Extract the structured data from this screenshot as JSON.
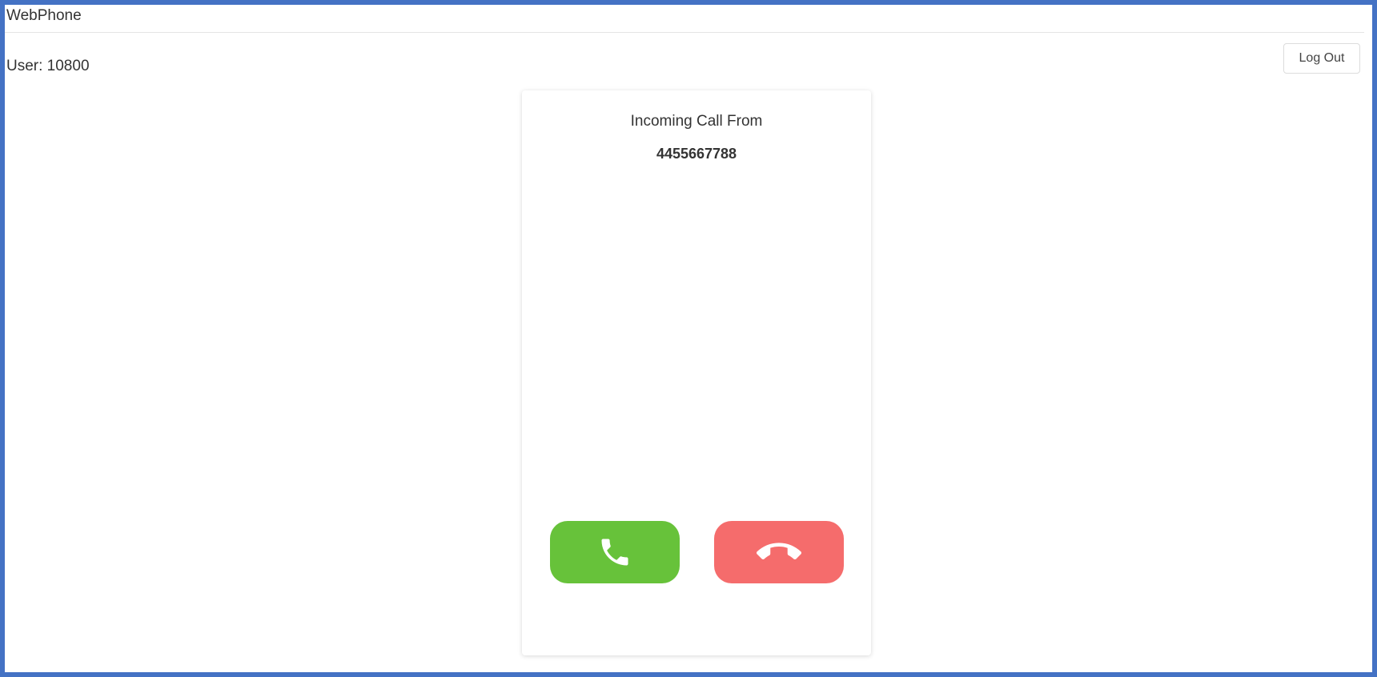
{
  "app": {
    "title": "WebPhone"
  },
  "header": {
    "user_label": "User: 10800",
    "logout_label": "Log Out"
  },
  "call": {
    "heading": "Incoming Call From",
    "caller_number": "4455667788",
    "answer_icon": "phone-icon",
    "decline_icon": "hang-up-icon"
  },
  "colors": {
    "frame_border": "#4472c4",
    "answer_button": "#67c23a",
    "decline_button": "#f56c6c",
    "text": "#333333"
  }
}
